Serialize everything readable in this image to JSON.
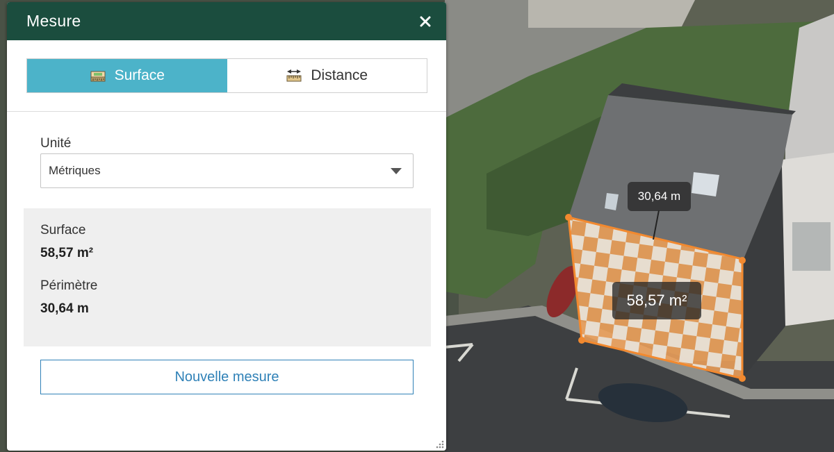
{
  "panel": {
    "title": "Mesure",
    "close_icon": "close-icon"
  },
  "tabs": [
    {
      "label": "Surface",
      "icon": "area-measure-icon",
      "active": true
    },
    {
      "label": "Distance",
      "icon": "distance-measure-icon",
      "active": false
    }
  ],
  "unit": {
    "label": "Unité",
    "selected": "Métriques"
  },
  "results": {
    "area_label": "Surface",
    "area_value": "58,57 m²",
    "perimeter_label": "Périmètre",
    "perimeter_value": "30,64 m"
  },
  "actions": {
    "new_measure_label": "Nouvelle mesure"
  },
  "map": {
    "perimeter_label": "30,64 m",
    "area_label": "58,57 m²",
    "measure_color": "#f2892f"
  },
  "colors": {
    "header_bg": "#1b4d3e",
    "active_tab_bg": "#4cb3c9",
    "link_blue": "#2f81b7"
  }
}
